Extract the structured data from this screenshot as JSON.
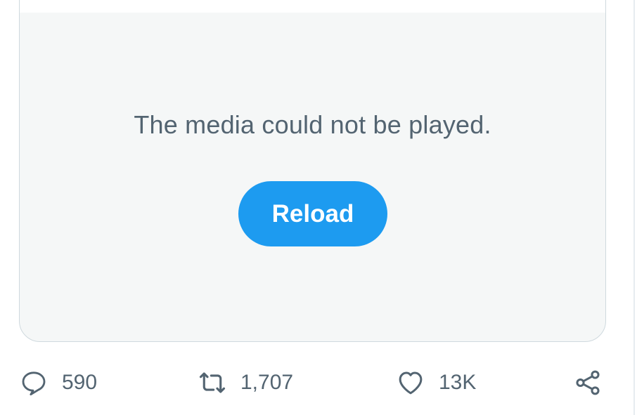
{
  "media": {
    "error_message": "The media could not be played.",
    "reload_label": "Reload"
  },
  "actions": {
    "reply": {
      "icon": "reply-icon",
      "count": "590"
    },
    "retweet": {
      "icon": "retweet-icon",
      "count": "1,707"
    },
    "like": {
      "icon": "heart-icon",
      "count": "13K"
    },
    "share": {
      "icon": "share-icon"
    }
  },
  "colors": {
    "accent": "#1d9bf0",
    "secondary_text": "#536471",
    "media_background": "#f5f7f7",
    "border": "#cfd9de"
  }
}
